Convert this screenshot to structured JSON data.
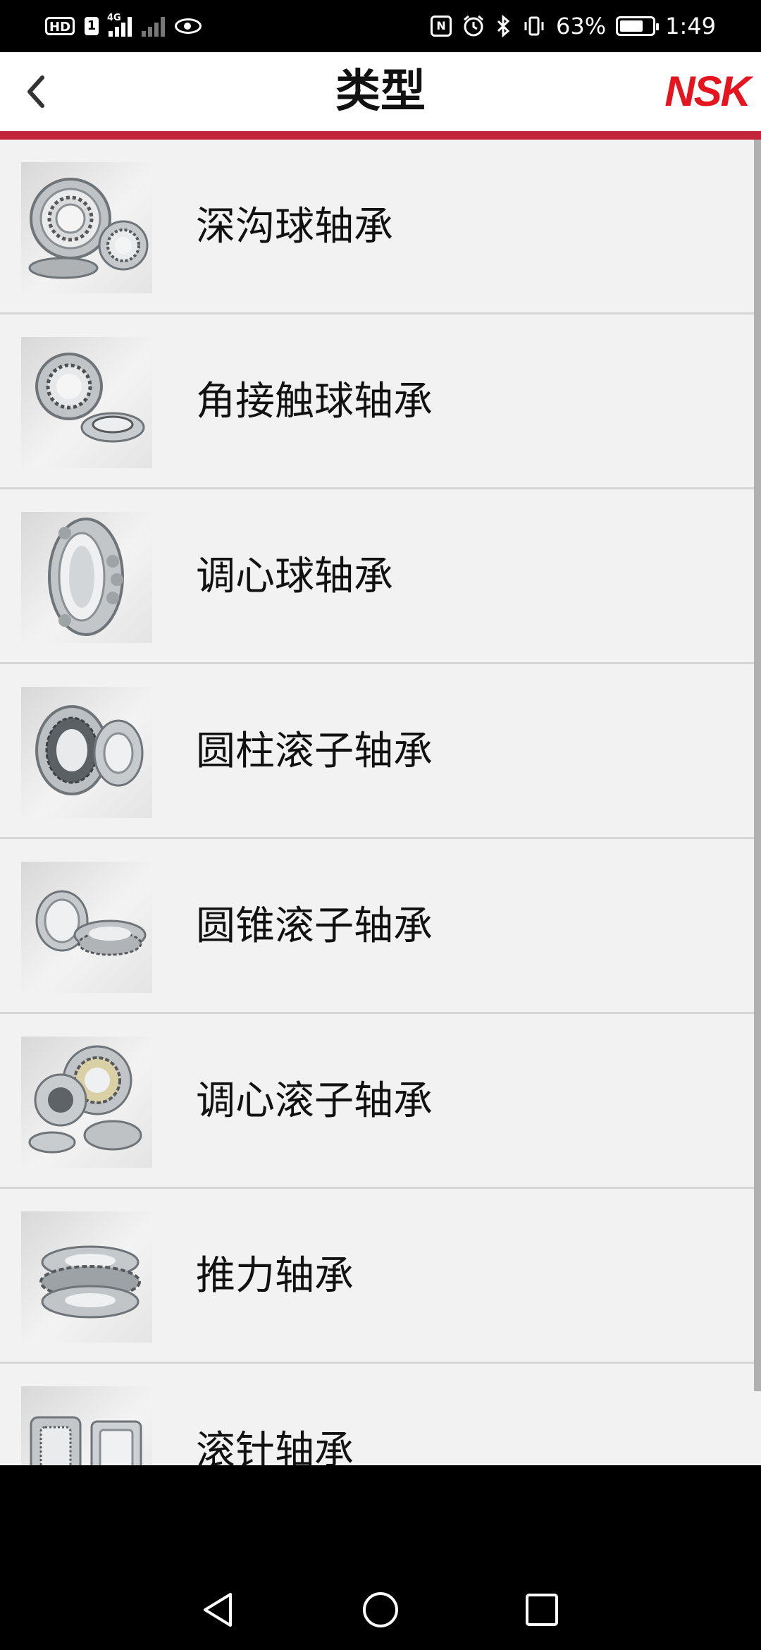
{
  "status_bar": {
    "hd": "HD",
    "sim": "1",
    "network": "4G",
    "battery_percent": "63%",
    "time": "1:49",
    "icons": [
      "hd-icon",
      "sim-icon",
      "signal-icon",
      "signal-off-icon",
      "eye-icon",
      "nfc-icon",
      "alarm-icon",
      "bluetooth-icon",
      "vibrate-icon",
      "battery-icon"
    ]
  },
  "header": {
    "title": "类型",
    "logo": "NSK",
    "back_icon": "chevron-left-icon",
    "rule_color": "#c2253a",
    "logo_color": "#e5141e"
  },
  "list": {
    "items": [
      {
        "label": "深沟球轴承",
        "icon": "deep-groove-ball-bearing-image"
      },
      {
        "label": "角接触球轴承",
        "icon": "angular-contact-ball-bearing-image"
      },
      {
        "label": "调心球轴承",
        "icon": "self-aligning-ball-bearing-image"
      },
      {
        "label": "圆柱滚子轴承",
        "icon": "cylindrical-roller-bearing-image"
      },
      {
        "label": "圆锥滚子轴承",
        "icon": "tapered-roller-bearing-image"
      },
      {
        "label": "调心滚子轴承",
        "icon": "spherical-roller-bearing-image"
      },
      {
        "label": "推力轴承",
        "icon": "thrust-bearing-image"
      },
      {
        "label": "滚针轴承",
        "icon": "needle-roller-bearing-image"
      }
    ]
  },
  "nav_bar": {
    "buttons": [
      "back-triangle-icon",
      "home-circle-icon",
      "recents-square-icon"
    ]
  }
}
